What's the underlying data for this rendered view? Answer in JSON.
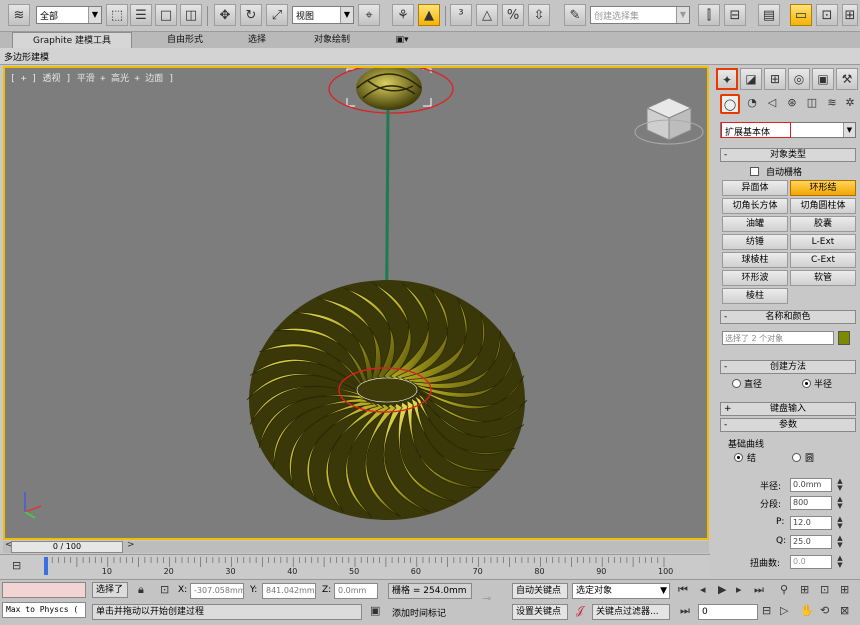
{
  "toolbar": {
    "selection_filter": "全部",
    "reference_coord": "视图",
    "named_selection_placeholder": "创建选择集"
  },
  "ribbon": {
    "tabs": [
      "Graphite 建模工具",
      "自由形式",
      "选择",
      "对象绘制"
    ],
    "sub_tab": "多边形建模"
  },
  "viewport": {
    "label": "[ + ] 透视 ] 平滑 + 高光 + 边面 ]"
  },
  "command_panel": {
    "category": "扩展基本体",
    "object_type_title": "对象类型",
    "autogrid_label": "自动栅格",
    "buttons": [
      "异面体",
      "环形结",
      "切角长方体",
      "切角圆柱体",
      "油罐",
      "胶囊",
      "纺锤",
      "L-Ext",
      "球棱柱",
      "C-Ext",
      "环形波",
      "软管",
      "棱柱"
    ],
    "active_button": "环形结",
    "name_color_title": "名称和颜色",
    "name_value": "选择了 2 个对象",
    "create_method_title": "创建方法",
    "create_method_options": [
      "直径",
      "半径"
    ],
    "create_method_selected": "半径",
    "keyboard_entry_title": "键盘输入",
    "params_title": "参数",
    "base_curve_title": "基础曲线",
    "curve_options": [
      "结",
      "圆"
    ],
    "curve_selected": "结",
    "radius_label": "半径:",
    "radius_value": "0.0mm",
    "segments_label": "分段:",
    "segments_value": "800",
    "p_label": "P:",
    "p_value": "12.0",
    "q_label": "Q:",
    "q_value": "25.0",
    "twist_label": "扭曲数:",
    "twist_value": "0.0"
  },
  "timeline": {
    "frame_display": "0 / 100",
    "ticks": [
      "10",
      "20",
      "30",
      "40",
      "50",
      "60",
      "70",
      "80",
      "90",
      "100"
    ]
  },
  "status": {
    "script_listener": "Max to Physcs (",
    "selected_text": "选择了",
    "x_label": "X:",
    "x_value": "-307.058mm",
    "y_label": "Y:",
    "y_value": "841.042mm",
    "z_label": "Z:",
    "z_value": "0.0mm",
    "grid_text": "栅格 = 254.0mm",
    "auto_key": "自动关键点",
    "set_key": "设置关键点",
    "key_filter_select": "选定对象",
    "key_filters": "关键点过滤器...",
    "prompt": "单击并拖动以开始创建过程",
    "add_time_tag": "添加时间标记",
    "current_frame": "0"
  },
  "colors": {
    "accent": "#f0c000",
    "object_color": "#b5b000",
    "annotation_red": "#e02020"
  }
}
